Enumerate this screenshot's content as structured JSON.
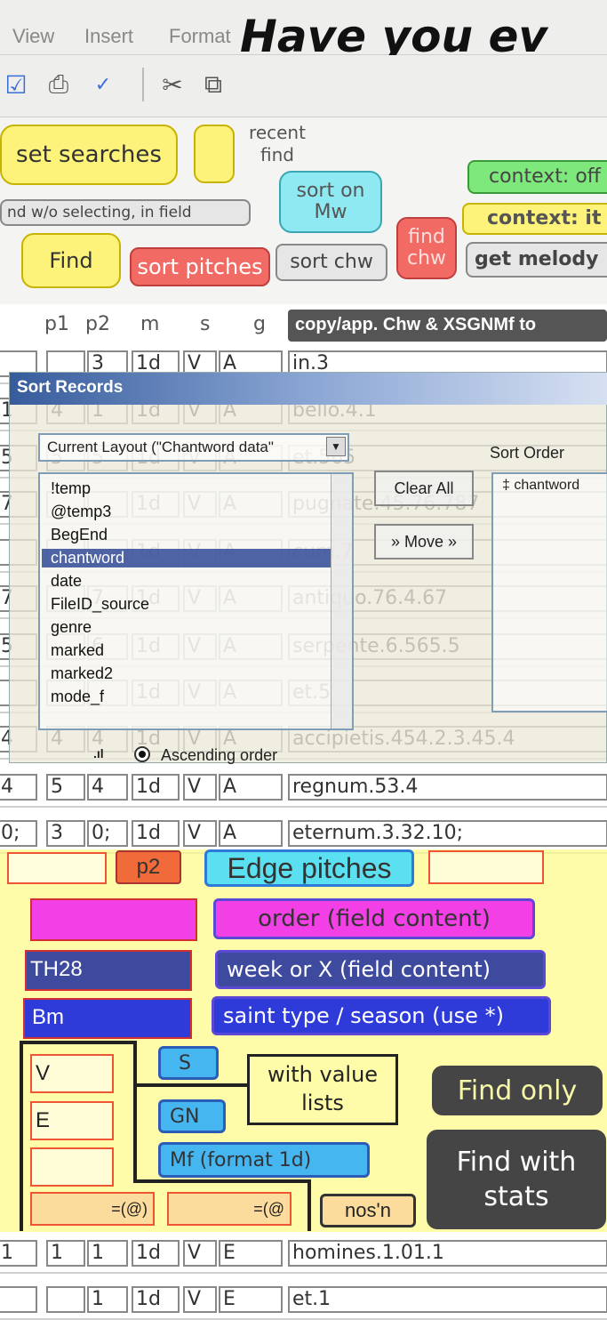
{
  "menu": {
    "view": "View",
    "insert": "Insert",
    "format": "Format"
  },
  "title": "Have you ev",
  "toolbar_icons": [
    "checkbox-icon",
    "print-icon",
    "spellcheck-icon",
    "cut-icon",
    "copy-icon"
  ],
  "buttons": {
    "set_searches": "set searches",
    "recent_find": "recent find",
    "find_wo": "nd w/o selecting, in field",
    "sort_on_mw": "sort on Mw",
    "find": "Find",
    "sort_pitches": "sort pitches",
    "sort_chw": "sort chw",
    "find_chw": "find chw",
    "context_off": "context: off",
    "context_it": "context: it",
    "get_melody": "get melody",
    "copy_app": "copy/app. Chw & XSGNMf to"
  },
  "columns": {
    "p1": "p1",
    "p2": "p2",
    "m": "m",
    "s": "s",
    "g": "g"
  },
  "rows": [
    {
      "c0": "",
      "p1": "",
      "p2": "3",
      "m": "1d",
      "s": "V",
      "g": "A",
      "chw": "in.3"
    },
    {
      "c0": "1",
      "p1": "4",
      "p2": "1",
      "m": "1d",
      "s": "V",
      "g": "A",
      "chw": "bello.4.1"
    },
    {
      "c0": "5",
      "p1": "5",
      "p2": "5",
      "m": "1d",
      "s": "V",
      "g": "A",
      "chw": "et.565"
    },
    {
      "c0": "7",
      "p1": "",
      "p2": "",
      "m": "1d",
      "s": "V",
      "g": "A",
      "chw": "pugnate.45.76.787"
    },
    {
      "c0": "",
      "p1": "",
      "p2": "",
      "m": "1d",
      "s": "V",
      "g": "A",
      "chw": "cum.7"
    },
    {
      "c0": "7",
      "p1": "",
      "p2": "7",
      "m": "1d",
      "s": "V",
      "g": "A",
      "chw": "antiquo.76.4.67"
    },
    {
      "c0": "5",
      "p1": "",
      "p2": "6",
      "m": "1d",
      "s": "V",
      "g": "A",
      "chw": "serpente.6.565.5"
    },
    {
      "c0": "",
      "p1": "",
      "p2": "",
      "m": "1d",
      "s": "V",
      "g": "A",
      "chw": "et.5"
    },
    {
      "c0": "4",
      "p1": "4",
      "p2": "4",
      "m": "1d",
      "s": "V",
      "g": "A",
      "chw": "accipietis.454.2.3.45.4"
    },
    {
      "c0": "4",
      "p1": "5",
      "p2": "4",
      "m": "1d",
      "s": "V",
      "g": "A",
      "chw": "regnum.53.4"
    },
    {
      "c0": "0;",
      "p1": "3",
      "p2": "0;",
      "m": "1d",
      "s": "V",
      "g": "A",
      "chw": "eternum.3.32.10;"
    },
    {
      "c0": "1",
      "p1": "1",
      "p2": "1",
      "m": "1d",
      "s": "V",
      "g": "E",
      "chw": "homines.1.01.1"
    },
    {
      "c0": "",
      "p1": "",
      "p2": "1",
      "m": "1d",
      "s": "V",
      "g": "E",
      "chw": "et.1"
    }
  ],
  "sort_dialog": {
    "title": "Sort Records",
    "layout_select": "Current Layout (\"Chantword data\"",
    "sort_order_label": "Sort Order",
    "sort_order_item": "‡ chantword",
    "clear_all": "Clear All",
    "move": "» Move »",
    "ascending": "Ascending order",
    "fields": [
      "!temp",
      "@temp3",
      "BegEnd",
      "chantword",
      "date",
      "FileID_source",
      "genre",
      "marked",
      "marked2",
      "mode_f"
    ]
  },
  "overlay": {
    "p2": "p2",
    "edge_pitches": "Edge pitches",
    "order": "order (field content)",
    "th28": "TH28",
    "week": "week or X (field content)",
    "bm": "Bm",
    "saint": "saint type / season (use *)",
    "s": "S",
    "with_value_lists": "with value lists",
    "find_only": "Find only",
    "v": "V",
    "gn": "GN",
    "e": "E",
    "mf": "Mf (format 1d)",
    "find_with_stats": "Find with stats",
    "eq1": "=(@)",
    "eq2": "=(@",
    "nos": "nos'n"
  },
  "colors": {
    "yellow": "#fdf27a",
    "red": "#f26a64",
    "cyan": "#8fe9f2",
    "green": "#7fe87c",
    "magenta": "#f23fe6",
    "navy": "#3d4a9e",
    "blue": "#2e3bd8",
    "sky": "#45b6f0",
    "dark": "#454545"
  }
}
